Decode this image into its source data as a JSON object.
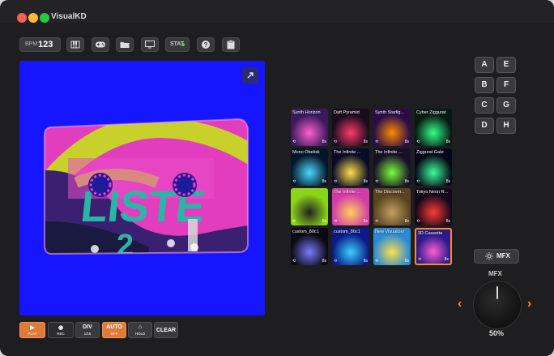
{
  "app": {
    "title": "VisualKD"
  },
  "toolbar": {
    "bpm_label": "BPM",
    "bpm_value": "123",
    "icons": [
      "piano-icon",
      "gamepad-icon",
      "folder-icon",
      "monitor-icon",
      "help-icon",
      "clipboard-icon"
    ],
    "stat_label": "STAT"
  },
  "presets": [
    {
      "name": "Synth Horizon",
      "count": "8s",
      "bg": "#3a1a5c",
      "accent": "#ff5fd0"
    },
    {
      "name": "Daft Pyramid",
      "count": "8s",
      "bg": "#1a0b1e",
      "accent": "#ff3b6a"
    },
    {
      "name": "Synth Starfig...",
      "count": "8s",
      "bg": "#2a0c4a",
      "accent": "#ff8a00"
    },
    {
      "name": "Cyber Ziggurat",
      "count": "8s",
      "bg": "#041a12",
      "accent": "#35ff8a"
    },
    {
      "name": "Mono Obelisk",
      "count": "8s",
      "bg": "#041628",
      "accent": "#4ad8ff"
    },
    {
      "name": "The Infinite ...",
      "count": "8s",
      "bg": "#0a0a28",
      "accent": "#ffe04a"
    },
    {
      "name": "The Infinite ...",
      "count": "8s",
      "bg": "#181028",
      "accent": "#7dff3a"
    },
    {
      "name": "Ziggurat Gate",
      "count": "8s",
      "bg": "#060818",
      "accent": "#3aff9a"
    },
    {
      "name": "",
      "count": "8s",
      "bg": "#8ad41a",
      "accent": "#222222"
    },
    {
      "name": "The Infinite ...",
      "count": "8s",
      "bg": "#d43aa8",
      "accent": "#ffd05a"
    },
    {
      "name": "The Discover...",
      "count": "8s",
      "bg": "#5a4420",
      "accent": "#c0a060"
    },
    {
      "name": "Tokyo Neon R...",
      "count": "8s",
      "bg": "#140818",
      "accent": "#ff3a3a"
    },
    {
      "name": "custom_80c1",
      "count": "8s",
      "bg": "#0a0a12",
      "accent": "#7a7aff"
    },
    {
      "name": "custom_80c1",
      "count": "8s",
      "bg": "#0b1a88",
      "accent": "#39d0ff"
    },
    {
      "name": "New Visualizer",
      "count": "8s",
      "bg": "#2a8ad4",
      "accent": "#ffe04a"
    },
    {
      "name": "3D Cassette",
      "count": "8s",
      "bg": "#2a1a8a",
      "accent": "#ff5fd0"
    }
  ],
  "keys": [
    "A",
    "E",
    "B",
    "F",
    "C",
    "G",
    "D",
    "H"
  ],
  "mfx": {
    "button_label": "MFX",
    "title": "MFX",
    "value": "50%",
    "level": 0.5
  },
  "transport": [
    {
      "label": "PLAY",
      "sub": "PLAY",
      "style": "orange"
    },
    {
      "label": "REC",
      "sub": "REC",
      "style": "dark"
    },
    {
      "label": "DIV",
      "sub": "1/16",
      "style": "gray"
    },
    {
      "label": "AUTO",
      "sub": "OFF",
      "style": "orange"
    },
    {
      "label": "HOLD",
      "sub": "HOLD",
      "style": "gray"
    },
    {
      "label": "CLEAR",
      "sub": "",
      "style": "gray"
    }
  ],
  "colors": {
    "viewport_bg": "#1515ff",
    "accent": "#ff8a2a",
    "selected_border": "#ff8a2a"
  }
}
